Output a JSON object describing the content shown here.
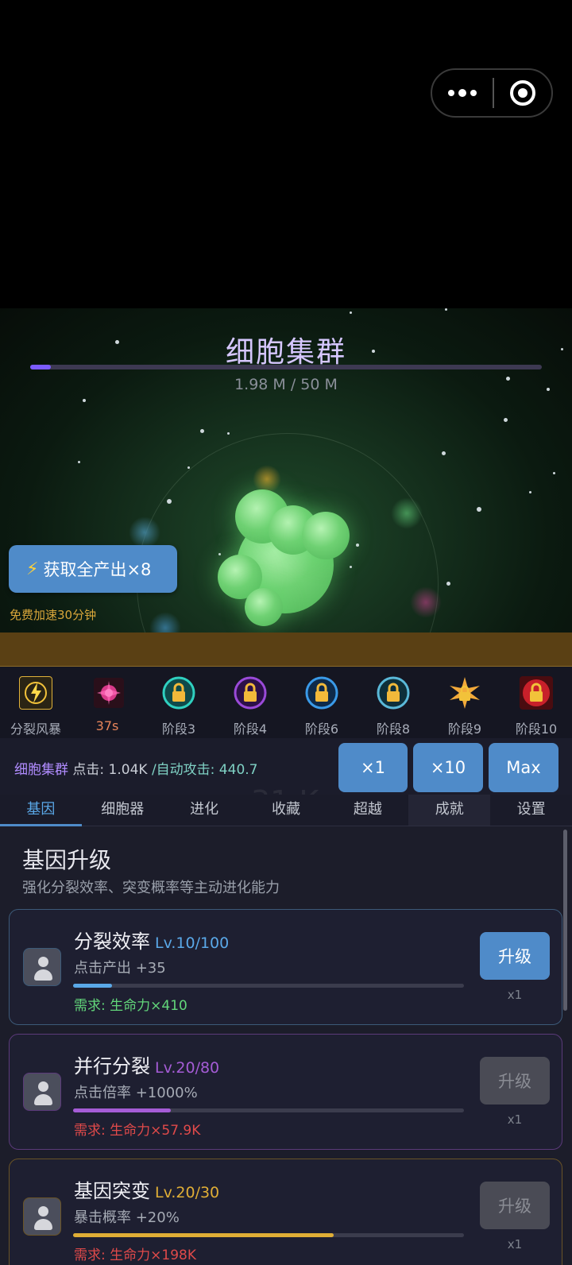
{
  "capsule": {
    "more_icon": "more-dots-icon",
    "close_icon": "target-close-icon"
  },
  "game": {
    "title": "细胞集群",
    "progress_text": "1.98 M / 50 M",
    "progress_fraction": 0.0396,
    "boost_button": "获取全产出×8",
    "free_speed": "免费加速30分钟"
  },
  "skills": [
    {
      "label": "分裂风暴",
      "icon": "storm-icon"
    },
    {
      "label": "37s",
      "icon": "burst-icon",
      "color": "#e8855a"
    },
    {
      "label": "阶段3",
      "icon": "lock-icon"
    },
    {
      "label": "阶段4",
      "icon": "lock-icon"
    },
    {
      "label": "阶段6",
      "icon": "lock-icon"
    },
    {
      "label": "阶段8",
      "icon": "lock-icon"
    },
    {
      "label": "阶段9",
      "icon": "lock-icon"
    },
    {
      "label": "阶段10",
      "icon": "lock-icon"
    }
  ],
  "info": {
    "name": "细胞集群",
    "click": "点击: 1.04K",
    "auto": "/自动攻击: 440.7"
  },
  "multipliers": [
    "×1",
    "×10",
    "Max"
  ],
  "ghost_number": "31 K",
  "tabs": [
    "基因",
    "细胞器",
    "进化",
    "收藏",
    "超越",
    "成就",
    "设置"
  ],
  "section": {
    "title": "基因升级",
    "subtitle": "强化分裂效率、突变概率等主动进化能力"
  },
  "cards": [
    {
      "name": "分裂效率",
      "level": "Lv.10/100",
      "effect": "点击产出 +35",
      "progress": 0.1,
      "requirement": "需求: 生命力×410",
      "button": "升级",
      "multiplier": "x1",
      "enabled": true,
      "accent": "#5aa8e8",
      "req_color": "#62d67a",
      "border": "#3c5a78"
    },
    {
      "name": "并行分裂",
      "level": "Lv.20/80",
      "effect": "点击倍率 +1000%",
      "progress": 0.25,
      "requirement": "需求: 生命力×57.9K",
      "button": "升级",
      "multiplier": "x1",
      "enabled": false,
      "accent": "#a55cd6",
      "req_color": "#e04a4a",
      "border": "#5b3a7a"
    },
    {
      "name": "基因突变",
      "level": "Lv.20/30",
      "effect": "暴击概率 +20%",
      "progress": 0.667,
      "requirement": "需求: 生命力×198K",
      "button": "升级",
      "multiplier": "x1",
      "enabled": false,
      "accent": "#e0ae36",
      "req_color": "#e04a4a",
      "border": "#6a5426"
    }
  ]
}
